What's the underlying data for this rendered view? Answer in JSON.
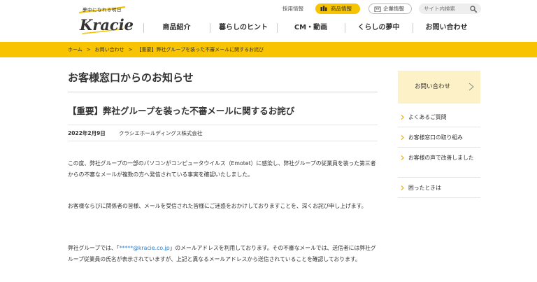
{
  "header": {
    "logo_tagline": "夢中になれる明日",
    "logo_text": "Kracie",
    "recruit_label": "採用情報",
    "products_label": "商品情報",
    "corporate_label": "企業情報",
    "search_placeholder": "サイト内検索"
  },
  "nav": {
    "items": [
      {
        "label": "商品紹介"
      },
      {
        "label": "暮らしのヒント"
      },
      {
        "label": "CM・動画"
      },
      {
        "label": "くらしの夢中"
      },
      {
        "label": "お問い合わせ"
      }
    ]
  },
  "breadcrumb": {
    "items": [
      {
        "label": "ホーム"
      },
      {
        "label": "お問い合わせ"
      },
      {
        "label": "【重要】弊社グループを装った不審メールに関するお詫び"
      }
    ],
    "separator": ">"
  },
  "main": {
    "page_title": "お客様窓口からのお知らせ",
    "article_title": "【重要】弊社グループを装った不審メールに関するお詫び",
    "date": "2022年2月9日",
    "company": "クラシエホールディングス株式会社",
    "para1": "この度、弊社グループの一部のパソコンがコンピュータウイルス（Emotet）に感染し、弊社グループの従業員を装った第三者からの不審なメールが複数の方へ発信されている事実を確認いたしました。",
    "para2": "お客様ならびに関係者の皆様、メールを受信された皆様にご迷惑をおかけしておりますことを、深くお詫び申し上げます。",
    "para3_before": "弊社グループでは、「",
    "para3_email": "*****@kracie.co.jp",
    "para3_after": "」のメールアドレスを利用しております。その不審なメールでは、送信者には弊社グループ従業員の氏名が表示されていますが、上記と異なるメールアドレスから送信されていることを確認しております。"
  },
  "sidebar": {
    "box_label": "お問い合わせ",
    "links": [
      {
        "label": "よくあるご質問"
      },
      {
        "label": "お客様窓口の取り組み"
      },
      {
        "label": "お客様の声で改善しました"
      },
      {
        "label": "困ったときは"
      }
    ]
  },
  "colors": {
    "brand_yellow": "#f8c300",
    "link_blue": "#2a7fcf",
    "sidebar_box": "#fdf2c7"
  }
}
